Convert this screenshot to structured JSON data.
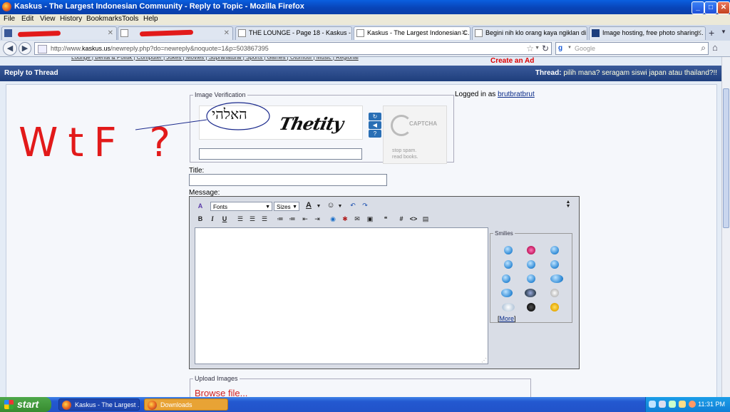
{
  "window": {
    "title": "Kaskus - The Largest Indonesian Community - Reply to Topic - Mozilla Firefox",
    "minimize": "_",
    "maximize": "□",
    "close": "✕"
  },
  "menu": [
    "File",
    "Edit",
    "View",
    "History",
    "Bookmarks",
    "Tools",
    "Help"
  ],
  "tabs": [
    {
      "label": "",
      "favicon": "facebook-icon"
    },
    {
      "label": "",
      "favicon": "page-icon"
    },
    {
      "label": "THE LOUNGE - Page 18 - Kaskus - ...",
      "favicon": "kaskus-icon"
    },
    {
      "label": "Kaskus - The Largest Indonesian C...",
      "favicon": "kaskus-icon",
      "active": true
    },
    {
      "label": "Begini nih klo orang kaya ngiklan di...",
      "favicon": "kaskus-icon"
    },
    {
      "label": "Image hosting, free photo sharing...",
      "favicon": "photobucket-icon"
    }
  ],
  "tab_new": "+",
  "nav": {
    "url_prefix": "http://www.",
    "url_domain": "kaskus.us",
    "url_path": "/newreply.php?do=newreply&noquote=1&p=503867395",
    "search_placeholder": "Google"
  },
  "page": {
    "ad_text": "Create an Ad",
    "reply_title": "Reply to Thread",
    "thread_label": "Thread:",
    "thread_title": "pilih mana? seragam siswi japan atau thailand?!!",
    "image_verification_legend": "Image Verification",
    "captcha_hebrew": "האלהי",
    "captcha_word": "Thetity",
    "captcha_brand": "CAPTCHA",
    "captcha_slogan_1": "stop spam.",
    "captcha_slogan_2": "read books.",
    "logged_in_label": "Logged in as",
    "username": "brutbratbrut",
    "title_label": "Title:",
    "message_label": "Message:",
    "font_select": "Fonts",
    "size_select": "Sizes",
    "smilies_legend": "Smilies",
    "more_link": "More",
    "upload_legend": "Upload Images",
    "browse_link": "Browse file...",
    "annotation": "WtF ?"
  },
  "taskbar": {
    "start_label": "start",
    "tasks": [
      {
        "label": "Kaskus - The Largest ...",
        "icon": "firefox-icon"
      },
      {
        "label": "Downloads",
        "icon": "firefox-icon"
      }
    ],
    "clock": "11:31 PM"
  },
  "colors": {
    "title_bar": "#0844b8",
    "header_blue": "#1e3e7c",
    "annotation_red": "#e21a1a",
    "taskbar": "#2358d0",
    "start_green": "#378b2f"
  }
}
